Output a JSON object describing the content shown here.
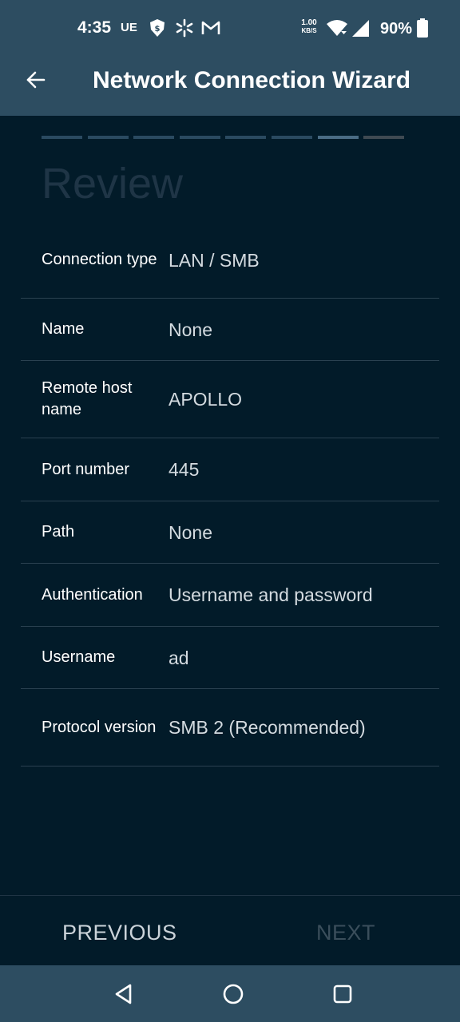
{
  "status_bar": {
    "time": "4:35",
    "carrier_badge": "UE",
    "net_speed_value": "1.00",
    "net_speed_unit": "KB/S",
    "battery_percent": "90%",
    "icons": [
      "shield-badge-icon",
      "sparkle-icon",
      "gmail-icon",
      "wifi-icon",
      "signal-icon",
      "battery-icon"
    ]
  },
  "app_bar": {
    "title": "Network Connection Wizard",
    "back_icon": "arrow-left-icon"
  },
  "wizard": {
    "total_steps": 8,
    "current_step": 7,
    "heading": "Review"
  },
  "review": {
    "rows": [
      {
        "label": "Connection type",
        "value": "LAN / SMB"
      },
      {
        "label": "Name",
        "value": "None"
      },
      {
        "label": "Remote host name",
        "value": "APOLLO"
      },
      {
        "label": "Port number",
        "value": "445"
      },
      {
        "label": "Path",
        "value": "None"
      },
      {
        "label": "Authentication",
        "value": "Username and password"
      },
      {
        "label": "Username",
        "value": "ad"
      },
      {
        "label": "Protocol version",
        "value": "SMB 2 (Recommended)"
      }
    ]
  },
  "actions": {
    "previous_label": "PREVIOUS",
    "next_label": "NEXT"
  },
  "nav_bar": {
    "icons": [
      "back-triangle-icon",
      "home-circle-icon",
      "recents-square-icon"
    ]
  },
  "colors": {
    "app_bar": "#2d4d61",
    "background": "#021b29",
    "progress_done": "#2a4a60",
    "progress_current": "#4a6c84",
    "progress_pending": "#3f4a52"
  }
}
